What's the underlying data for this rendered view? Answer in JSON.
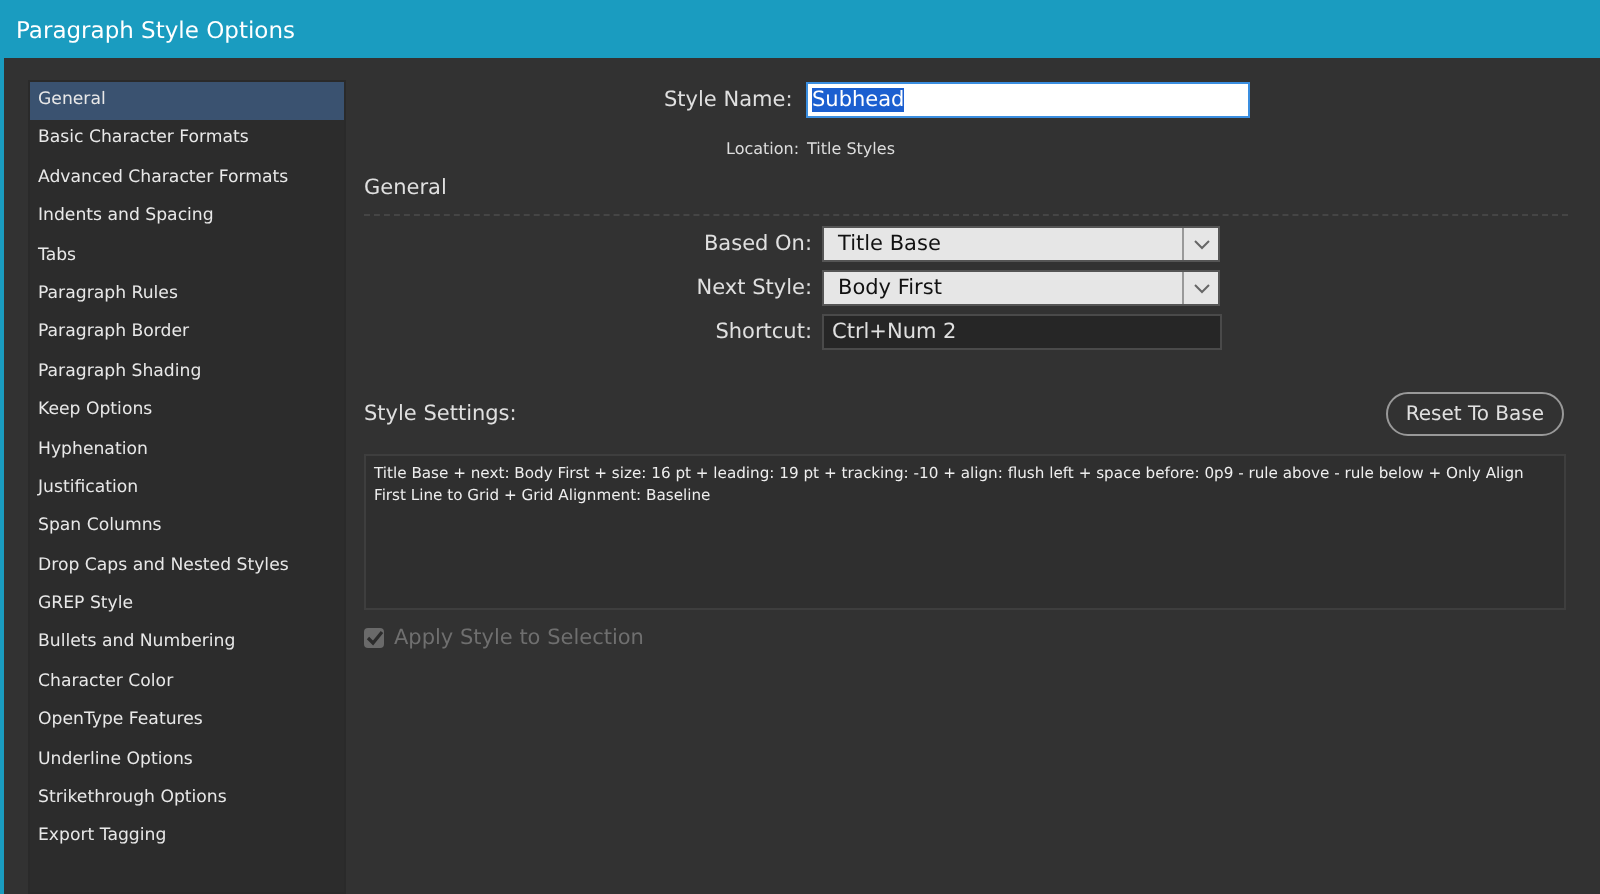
{
  "window": {
    "title": "Paragraph Style Options"
  },
  "sidebar": {
    "items": [
      {
        "label": "General",
        "selected": true
      },
      {
        "label": "Basic Character Formats",
        "selected": false
      },
      {
        "label": "Advanced Character Formats",
        "selected": false
      },
      {
        "label": "Indents and Spacing",
        "selected": false
      },
      {
        "label": "Tabs",
        "selected": false
      },
      {
        "label": "Paragraph Rules",
        "selected": false
      },
      {
        "label": "Paragraph Border",
        "selected": false
      },
      {
        "label": "Paragraph Shading",
        "selected": false
      },
      {
        "label": "Keep Options",
        "selected": false
      },
      {
        "label": "Hyphenation",
        "selected": false
      },
      {
        "label": "Justification",
        "selected": false
      },
      {
        "label": "Span Columns",
        "selected": false
      },
      {
        "label": "Drop Caps and Nested Styles",
        "selected": false
      },
      {
        "label": "GREP Style",
        "selected": false
      },
      {
        "label": "Bullets and Numbering",
        "selected": false
      },
      {
        "label": "Character Color",
        "selected": false
      },
      {
        "label": "OpenType Features",
        "selected": false
      },
      {
        "label": "Underline Options",
        "selected": false
      },
      {
        "label": "Strikethrough Options",
        "selected": false
      },
      {
        "label": "Export Tagging",
        "selected": false
      }
    ]
  },
  "style_name": {
    "label": "Style Name:",
    "value": "Subhead",
    "selected_text": true
  },
  "location": {
    "label": "Location:",
    "value": "Title Styles"
  },
  "section_title": "General",
  "fields": [
    {
      "kind": "dropdown",
      "label": "Based On:",
      "value": "Title Base"
    },
    {
      "kind": "dropdown",
      "label": "Next Style:",
      "value": "Body First"
    },
    {
      "kind": "text",
      "label": "Shortcut:",
      "value": "Ctrl+Num 2"
    }
  ],
  "style_settings": {
    "label": "Style Settings:",
    "reset_button": "Reset To Base",
    "text": "Title Base + next: Body First + size: 16 pt + leading: 19 pt + tracking: -10 + align: flush left + space before: 0p9 - rule above - rule below + Only Align First Line to Grid + Grid Alignment:  Baseline"
  },
  "apply_checkbox": {
    "label": "Apply Style to Selection",
    "checked": true,
    "disabled": true
  }
}
